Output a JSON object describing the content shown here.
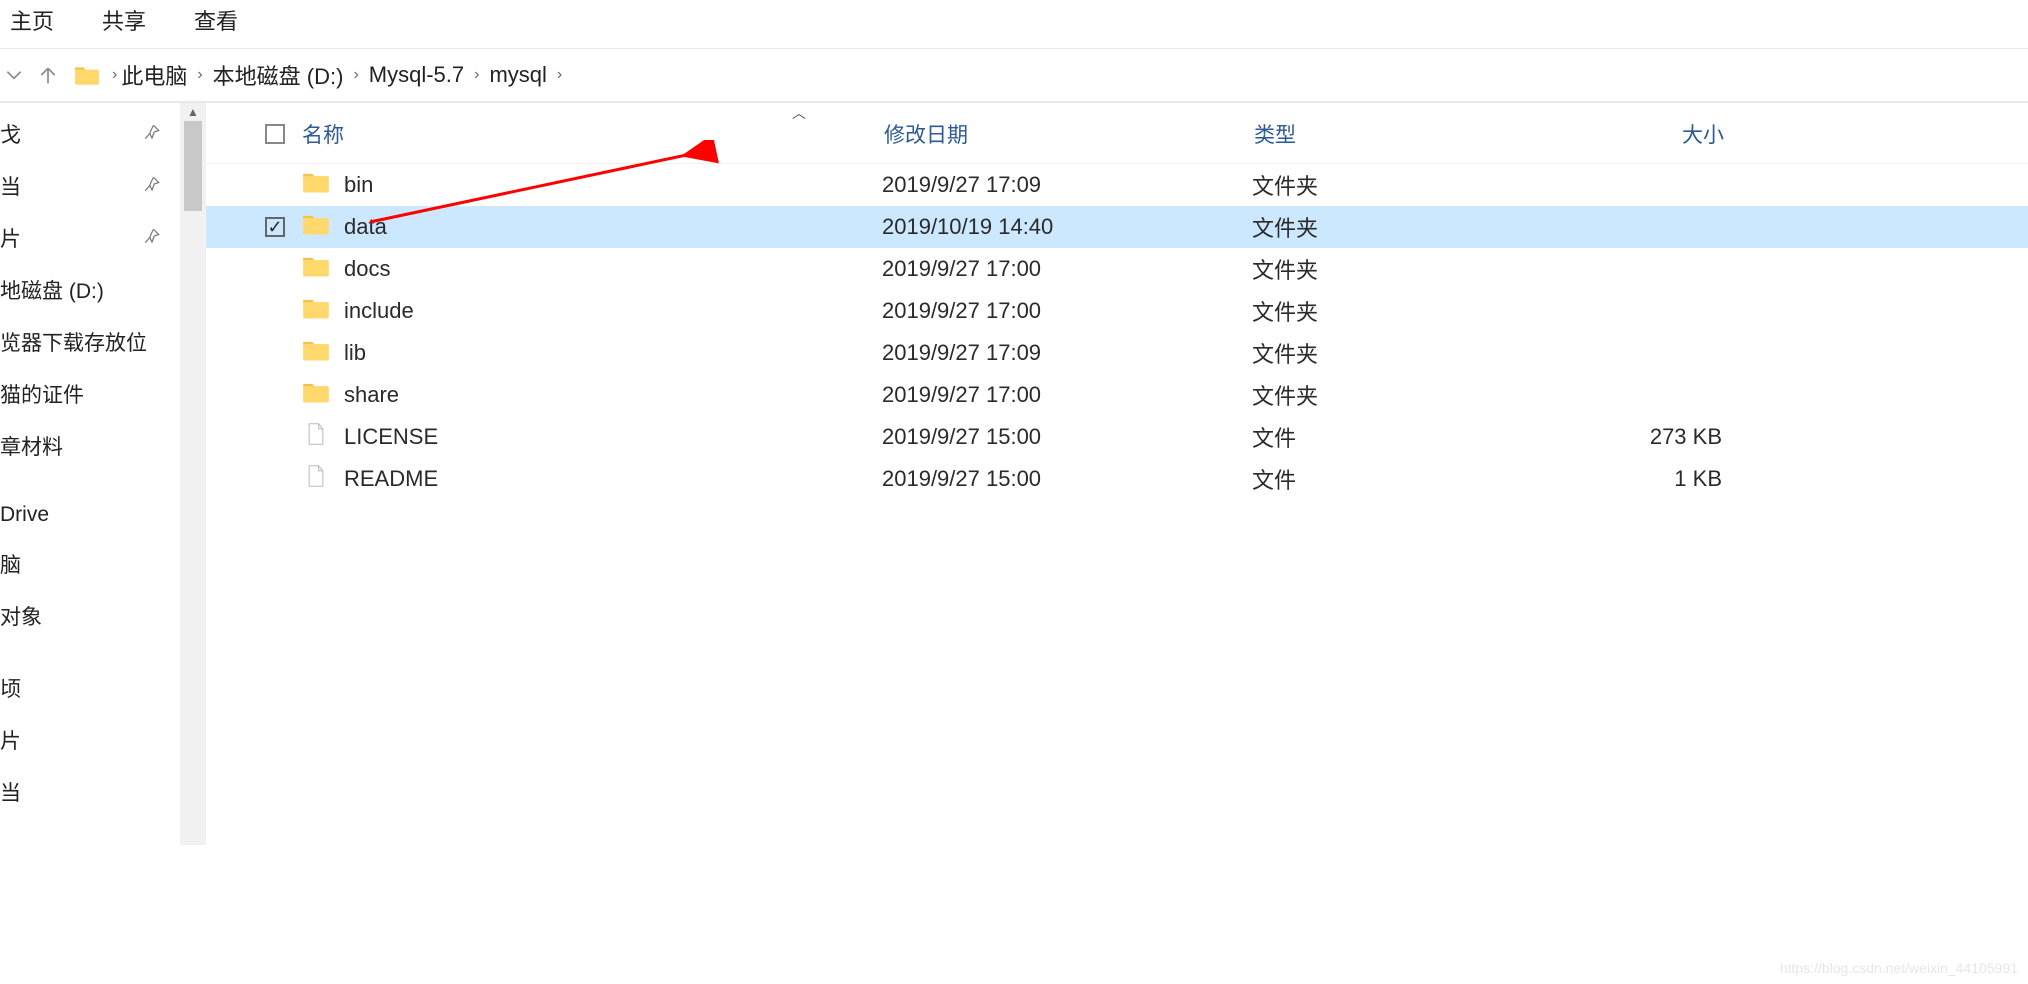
{
  "ribbon": {
    "tabs": [
      "主页",
      "共享",
      "查看"
    ]
  },
  "breadcrumb": {
    "items": [
      "此电脑",
      "本地磁盘 (D:)",
      "Mysql-5.7",
      "mysql"
    ]
  },
  "sidebar": {
    "items": [
      {
        "label": "戈",
        "pinned": true
      },
      {
        "label": "当",
        "pinned": true
      },
      {
        "label": "片",
        "pinned": true
      },
      {
        "label": "地磁盘 (D:)",
        "pinned": false
      },
      {
        "label": "览器下载存放位",
        "pinned": false
      },
      {
        "label": "猫的证件",
        "pinned": false
      },
      {
        "label": "章材料",
        "pinned": false
      },
      {
        "label": "Drive",
        "pinned": false
      },
      {
        "label": "脑",
        "pinned": false
      },
      {
        "label": "对象",
        "pinned": false
      },
      {
        "label": "顷",
        "pinned": false
      },
      {
        "label": "片",
        "pinned": false
      },
      {
        "label": "当",
        "pinned": false
      }
    ]
  },
  "columns": {
    "name": "名称",
    "date": "修改日期",
    "type": "类型",
    "size": "大小"
  },
  "files": [
    {
      "name": "bin",
      "date": "2019/9/27 17:09",
      "type": "文件夹",
      "size": "",
      "kind": "folder",
      "selected": false
    },
    {
      "name": "data",
      "date": "2019/10/19 14:40",
      "type": "文件夹",
      "size": "",
      "kind": "folder",
      "selected": true
    },
    {
      "name": "docs",
      "date": "2019/9/27 17:00",
      "type": "文件夹",
      "size": "",
      "kind": "folder",
      "selected": false
    },
    {
      "name": "include",
      "date": "2019/9/27 17:00",
      "type": "文件夹",
      "size": "",
      "kind": "folder",
      "selected": false
    },
    {
      "name": "lib",
      "date": "2019/9/27 17:09",
      "type": "文件夹",
      "size": "",
      "kind": "folder",
      "selected": false
    },
    {
      "name": "share",
      "date": "2019/9/27 17:00",
      "type": "文件夹",
      "size": "",
      "kind": "folder",
      "selected": false
    },
    {
      "name": "LICENSE",
      "date": "2019/9/27 15:00",
      "type": "文件",
      "size": "273 KB",
      "kind": "file",
      "selected": false
    },
    {
      "name": "README",
      "date": "2019/9/27 15:00",
      "type": "文件",
      "size": "1 KB",
      "kind": "file",
      "selected": false
    }
  ],
  "watermark": "https://blog.csdn.net/weixin_44105991"
}
